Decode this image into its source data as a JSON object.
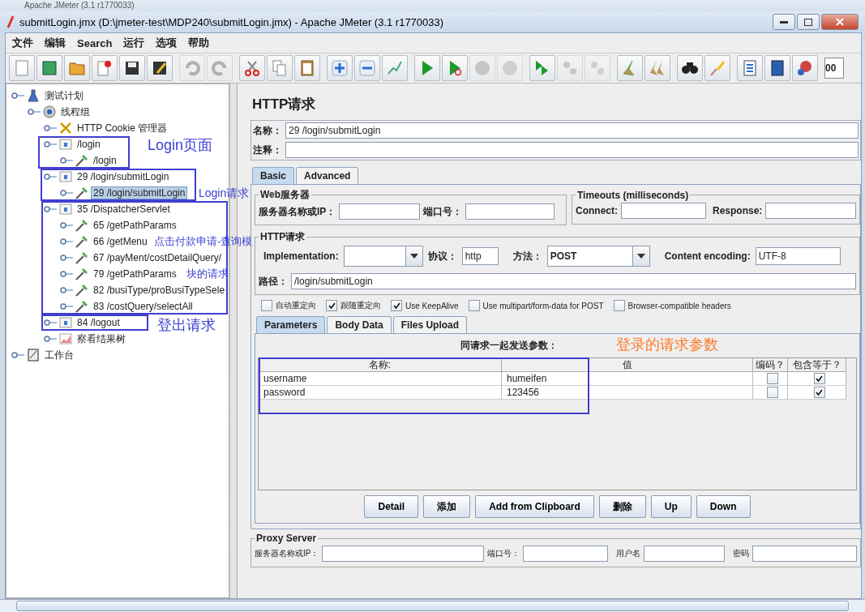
{
  "background_window": {
    "title": "Apache JMeter (3.1 r1770033)"
  },
  "window": {
    "title": "submitLogin.jmx (D:\\jmeter-test\\MDP240\\submitLogin.jmx) - Apache JMeter (3.1 r1770033)"
  },
  "menu": [
    "文件",
    "编辑",
    "Search",
    "运行",
    "选项",
    "帮助"
  ],
  "toolbar": [
    [
      {
        "disabled": false
      },
      {
        "disabled": false
      },
      {
        "disabled": false
      },
      {
        "disabled": false
      },
      {
        "disabled": false
      },
      {
        "disabled": false
      }
    ],
    [
      {
        "disabled": true
      },
      {
        "disabled": true
      }
    ],
    [
      {
        "disabled": false
      },
      {
        "disabled": false
      },
      {
        "disabled": false
      }
    ],
    [
      {
        "disabled": false
      },
      {
        "disabled": false
      },
      {
        "disabled": false
      }
    ],
    [
      {
        "disabled": false
      },
      {
        "disabled": false
      },
      {
        "disabled": true
      },
      {
        "disabled": true
      }
    ],
    [
      {
        "disabled": false
      },
      {
        "disabled": true
      },
      {
        "disabled": true
      }
    ],
    [
      {
        "disabled": false
      },
      {
        "disabled": false
      }
    ],
    [
      {
        "disabled": false
      },
      {
        "disabled": false
      }
    ],
    [
      {
        "disabled": false
      },
      {
        "disabled": false
      },
      {
        "disabled": false
      }
    ]
  ],
  "toolbar_field": "00",
  "tree": [
    {
      "label": "测试计划",
      "kind": "plan",
      "selected": false,
      "children": [
        {
          "label": "线程组",
          "kind": "threads",
          "selected": false,
          "children": [
            {
              "label": "HTTP Cookie 管理器",
              "kind": "config",
              "selected": false
            },
            {
              "label": "/login",
              "kind": "controller",
              "selected": false,
              "children": [
                {
                  "label": "/login",
                  "kind": "sampler",
                  "selected": false
                }
              ]
            },
            {
              "label": "29 /login/submitLogin",
              "kind": "controller",
              "selected": false,
              "children": [
                {
                  "label": "29 /login/submitLogin",
                  "kind": "sampler",
                  "selected": true
                }
              ]
            },
            {
              "label": "35 /DispatcherServlet",
              "kind": "controller",
              "selected": false,
              "children": [
                {
                  "label": "65 /getPathParams",
                  "kind": "sampler",
                  "selected": false
                },
                {
                  "label": "66 /getMenu",
                  "kind": "sampler",
                  "selected": false
                },
                {
                  "label": "67 /payMent/costDetailQuery/",
                  "kind": "sampler",
                  "selected": false
                },
                {
                  "label": "79 /getPathParams",
                  "kind": "sampler",
                  "selected": false
                },
                {
                  "label": "82 /busiType/proBusiTypeSele",
                  "kind": "sampler",
                  "selected": false
                },
                {
                  "label": "83 /costQuery/selectAll",
                  "kind": "sampler",
                  "selected": false
                }
              ]
            },
            {
              "label": "84 /logout",
              "kind": "controller",
              "selected": false
            },
            {
              "label": "察看结果树",
              "kind": "listener",
              "selected": false
            }
          ]
        }
      ]
    },
    {
      "label": "工作台",
      "kind": "workbench",
      "selected": false
    }
  ],
  "panel": {
    "title": "HTTP请求",
    "name_label": "名称：",
    "name_value": "29 /login/submitLogin",
    "comment_label": "注释：",
    "tabs": [
      {
        "label": "Basic",
        "selected": true
      },
      {
        "label": "Advanced",
        "selected": false
      }
    ],
    "web_server": {
      "title": "Web服务器",
      "server_label": "服务器名称或IP：",
      "port_label": "端口号："
    },
    "timeouts": {
      "title": "Timeouts (milliseconds)",
      "connect_label": "Connect:",
      "response_label": "Response:"
    },
    "http_request": {
      "title": "HTTP请求",
      "implementation_label": "Implementation:",
      "protocol_label": "协议：",
      "protocol_value": "http",
      "method_label": "方法：",
      "method_value": "POST",
      "encoding_label": "Content encoding:",
      "encoding_value": "UTF-8",
      "path_label": "路径：",
      "path_value": "/login/submitLogin"
    },
    "options": [
      {
        "label": "自动重定向",
        "checked": false
      },
      {
        "label": "跟随重定向",
        "checked": true
      },
      {
        "label": "Use KeepAlive",
        "checked": true
      },
      {
        "label": "Use multipart/form-data for POST",
        "checked": false
      },
      {
        "label": "Browser-compatible headers",
        "checked": false
      }
    ],
    "sub_tabs": [
      {
        "label": "Parameters",
        "selected": true
      },
      {
        "label": "Body Data",
        "selected": false
      },
      {
        "label": "Files Upload",
        "selected": false
      }
    ],
    "params_title": "同请求一起发送参数：",
    "params": {
      "columns": [
        "名称:",
        "值",
        "编码？",
        "包含等于？"
      ],
      "rows": [
        {
          "name": "username",
          "value": "humeifen",
          "encode": false,
          "include_equals": true
        },
        {
          "name": "password",
          "value": "123456",
          "encode": false,
          "include_equals": true
        }
      ]
    },
    "buttons": [
      "Detail",
      "添加",
      "Add from Clipboard",
      "删除",
      "Up",
      "Down"
    ],
    "proxy": {
      "title": "Proxy Server",
      "server_label": "服务器名称或IP：",
      "port_label": "端口号：",
      "user_label": "用户名",
      "password_label": "密码"
    }
  },
  "annotations": [
    "Login页面",
    "Login请求",
    "点击付款申请-查询模",
    "块的请求",
    "登出请求",
    "登录的请求参数"
  ]
}
